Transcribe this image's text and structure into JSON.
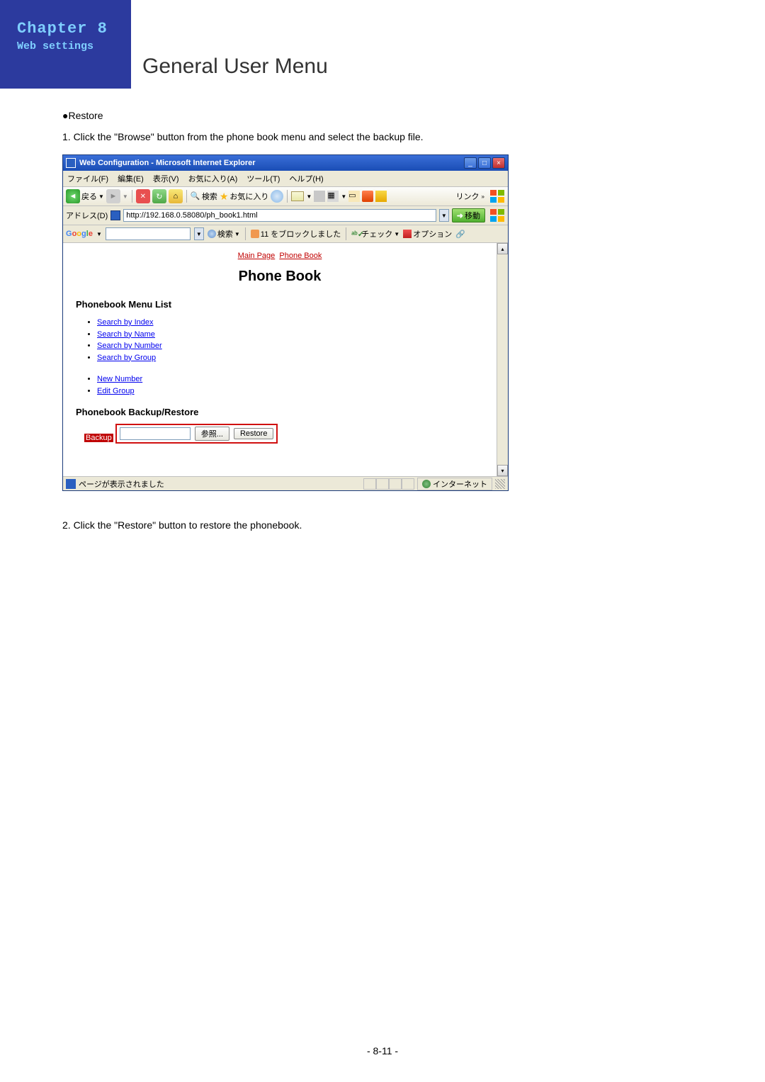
{
  "header": {
    "chapter": "Chapter 8",
    "subtitle": "Web settings",
    "section": "General User Menu"
  },
  "body": {
    "restore_heading": "●Restore",
    "step1": "1. Click the \"Browse\" button from the phone book menu and select the backup file.",
    "step2": "2. Click the \"Restore\" button to restore the phonebook."
  },
  "ie": {
    "title": "Web Configuration - Microsoft Internet Explorer",
    "menu": {
      "file": "ファイル(F)",
      "edit": "編集(E)",
      "view": "表示(V)",
      "fav": "お気に入り(A)",
      "tools": "ツール(T)",
      "help": "ヘルプ(H)"
    },
    "toolbar": {
      "back": "戻る",
      "search": "検索",
      "fav": "お気に入り",
      "links": "リンク"
    },
    "addr": {
      "label": "アドレス(D)",
      "url": "http://192.168.0.58080/ph_book1.html",
      "go": "移動"
    },
    "google": {
      "search_btn": "検索",
      "blocked": "11 をブロックしました",
      "check": "チェック",
      "option": "オプション"
    },
    "page": {
      "crumb_main": "Main Page",
      "crumb_pb": "Phone Book",
      "title": "Phone Book",
      "menu_h": "Phonebook Menu List",
      "links1": [
        "Search by Index",
        "Search by Name",
        "Search by Number",
        "Search by Group"
      ],
      "links2": [
        "New Number",
        "Edit Group"
      ],
      "br_h": "Phonebook Backup/Restore",
      "backup": "Backup",
      "browse": "参照...",
      "restore": "Restore"
    },
    "status": {
      "text": "ページが表示されました",
      "zone": "インターネット"
    }
  },
  "footer": {
    "page": "- 8-11 -"
  }
}
